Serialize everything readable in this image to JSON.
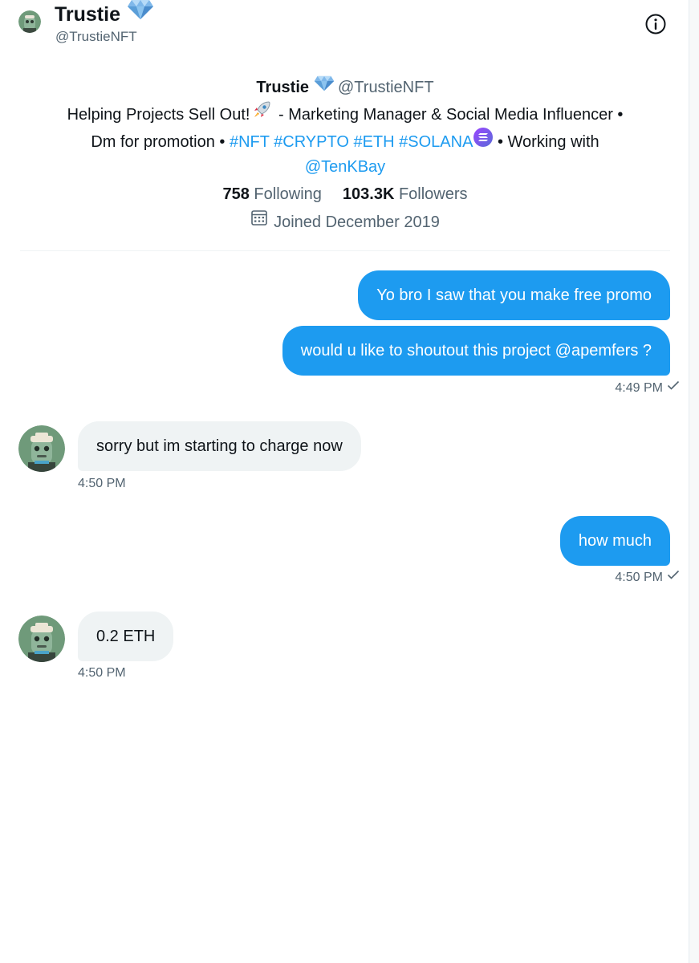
{
  "header": {
    "name": "Trustie",
    "handle": "@TrustieNFT"
  },
  "profile": {
    "name": "Trustie",
    "handle": "@TrustieNFT",
    "bio": {
      "part1": "Helping Projects Sell Out!",
      "part2": " - Marketing Manager & Social Media Influencer •",
      "part3": "Dm for promotion •",
      "tag_nft": "#NFT",
      "tag_crypto": "#CRYPTO",
      "tag_eth": "#ETH",
      "tag_solana": "#SOLANA",
      "part4": "• Working with",
      "mention": "@TenKBay"
    },
    "following_count": "758",
    "following_label": "Following",
    "followers_count": "103.3K",
    "followers_label": "Followers",
    "joined": "Joined December 2019"
  },
  "messages": [
    {
      "from": "me",
      "text": "Yo bro I saw that you make free promo"
    },
    {
      "from": "me",
      "text": "would u like to shoutout this project @apemfers ?",
      "time": "4:49 PM"
    },
    {
      "from": "them",
      "text": "sorry but im starting to charge now",
      "time": "4:50 PM"
    },
    {
      "from": "me",
      "text": "how much",
      "time": "4:50 PM"
    },
    {
      "from": "them",
      "text": "0.2 ETH",
      "time": "4:50 PM"
    }
  ],
  "colors": {
    "accent": "#1d9bf0",
    "received_bubble": "#eff3f4",
    "muted_text": "#536471"
  },
  "icons": {
    "verified": "diamond-icon",
    "info": "info-icon",
    "calendar": "calendar-icon",
    "read_receipt": "check-icon"
  }
}
